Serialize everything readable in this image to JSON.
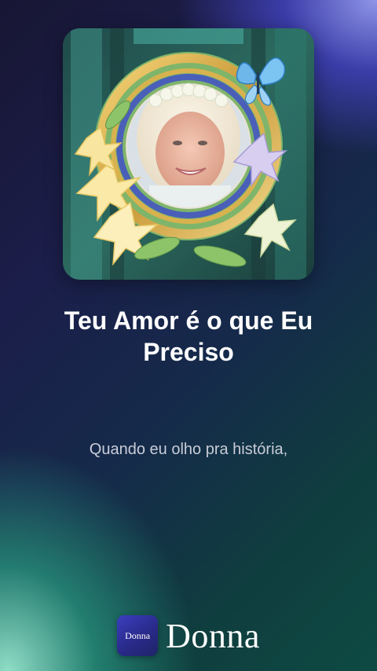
{
  "song": {
    "title": "Teu Amor é o que Eu Preciso",
    "lyric_line": "Quando eu olho pra história,"
  },
  "artwork": {
    "subject": "smiling woman with flower crown in floral golden frame",
    "butterfly": "butterfly-icon"
  },
  "brand": {
    "logo_text": "Donna",
    "name": "Donna"
  },
  "colors": {
    "background_top_right": "#5a5ee0",
    "background_bottom_left": "#7fe0c4",
    "background_mid": "#1b1e4a",
    "text_primary": "#ffffff",
    "text_secondary": "#c9ccd8"
  }
}
